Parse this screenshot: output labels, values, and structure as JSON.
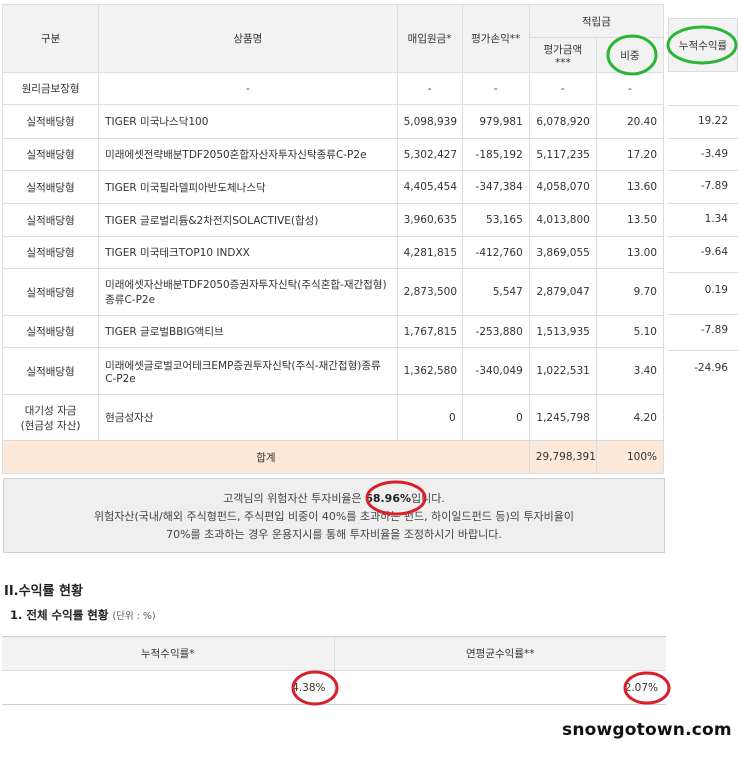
{
  "holdings": {
    "headers": {
      "type": "구분",
      "product": "상품명",
      "purchase": "매입원금*",
      "gain": "평가손익**",
      "reserve_group": "적립금",
      "eval_amount": "평가금액***",
      "weight": "비중",
      "cum_return": "누적수익률"
    },
    "guaranteed_row": {
      "type": "원리금보장형",
      "product": "-",
      "purchase": "-",
      "gain": "-",
      "eval_amount": "-",
      "weight": "-"
    },
    "rows": [
      {
        "type": "실적배당형",
        "product": "TIGER 미국나스닥100",
        "purchase": "5,098,939",
        "gain": "979,981",
        "eval_amount": "6,078,920",
        "weight": "20.40",
        "cum_return": "19.22"
      },
      {
        "type": "실적배당형",
        "product": "미래에셋전략배분TDF2050혼합자산자투자신탁종류C-P2e",
        "purchase": "5,302,427",
        "gain": "-185,192",
        "eval_amount": "5,117,235",
        "weight": "17.20",
        "cum_return": "-3.49"
      },
      {
        "type": "실적배당형",
        "product": "TIGER 미국필라델피아반도체나스닥",
        "purchase": "4,405,454",
        "gain": "-347,384",
        "eval_amount": "4,058,070",
        "weight": "13.60",
        "cum_return": "-7.89"
      },
      {
        "type": "실적배당형",
        "product": "TIGER 글로벌리튬&2차전지SOLACTIVE(합성)",
        "purchase": "3,960,635",
        "gain": "53,165",
        "eval_amount": "4,013,800",
        "weight": "13.50",
        "cum_return": "1.34"
      },
      {
        "type": "실적배당형",
        "product": "TIGER 미국테크TOP10 INDXX",
        "purchase": "4,281,815",
        "gain": "-412,760",
        "eval_amount": "3,869,055",
        "weight": "13.00",
        "cum_return": "-9.64"
      },
      {
        "type": "실적배당형",
        "product": "미래에셋자산배분TDF2050증권자투자신탁(주식혼합-재간접형)종류C-P2e",
        "purchase": "2,873,500",
        "gain": "5,547",
        "eval_amount": "2,879,047",
        "weight": "9.70",
        "cum_return": "0.19"
      },
      {
        "type": "실적배당형",
        "product": "TIGER 글로벌BBIG액티브",
        "purchase": "1,767,815",
        "gain": "-253,880",
        "eval_amount": "1,513,935",
        "weight": "5.10",
        "cum_return": "-7.89"
      },
      {
        "type": "실적배당형",
        "product": "미래에셋글로벌코어테크EMP증권투자신탁(주식-재간접형)종류C-P2e",
        "purchase": "1,362,580",
        "gain": "-340,049",
        "eval_amount": "1,022,531",
        "weight": "3.40",
        "cum_return": "-24.96"
      }
    ],
    "cash_row": {
      "type_line1": "대기성 자금",
      "type_line2": "(현금성 자산)",
      "product": "현금성자산",
      "purchase": "0",
      "gain": "0",
      "eval_amount": "1,245,798",
      "weight": "4.20"
    },
    "total": {
      "label": "합계",
      "eval_amount": "29,798,391",
      "weight": "100%"
    }
  },
  "notice": {
    "line1_before": "고객님의 위험자산 투자비율은 ",
    "percent": "68.96%",
    "line1_after": "입니다.",
    "line2": "위험자산(국내/해외 주식형펀드, 주식편입 비중이 40%를 초과하는 펀드, 하이일드펀드 등)의 투자비율이",
    "line3": "70%를 초과하는 경우 운용지시를 통해 투자비율을 조정하시기 바랍니다."
  },
  "returns_section": {
    "title": "II.수익률 현황",
    "subtitle": "1. 전체 수익률 현황",
    "unit": "(단위 : %)",
    "headers": {
      "cumulative": "누적수익률*",
      "annualized": "연평균수익률**"
    },
    "values": {
      "cumulative": "4.38%",
      "annualized": "2.07%"
    }
  },
  "watermark": "snowgotown.com",
  "colors": {
    "highlight_red": "#d9202a",
    "highlight_green": "#2bb534",
    "total_row_bg": "#fde9d9"
  }
}
